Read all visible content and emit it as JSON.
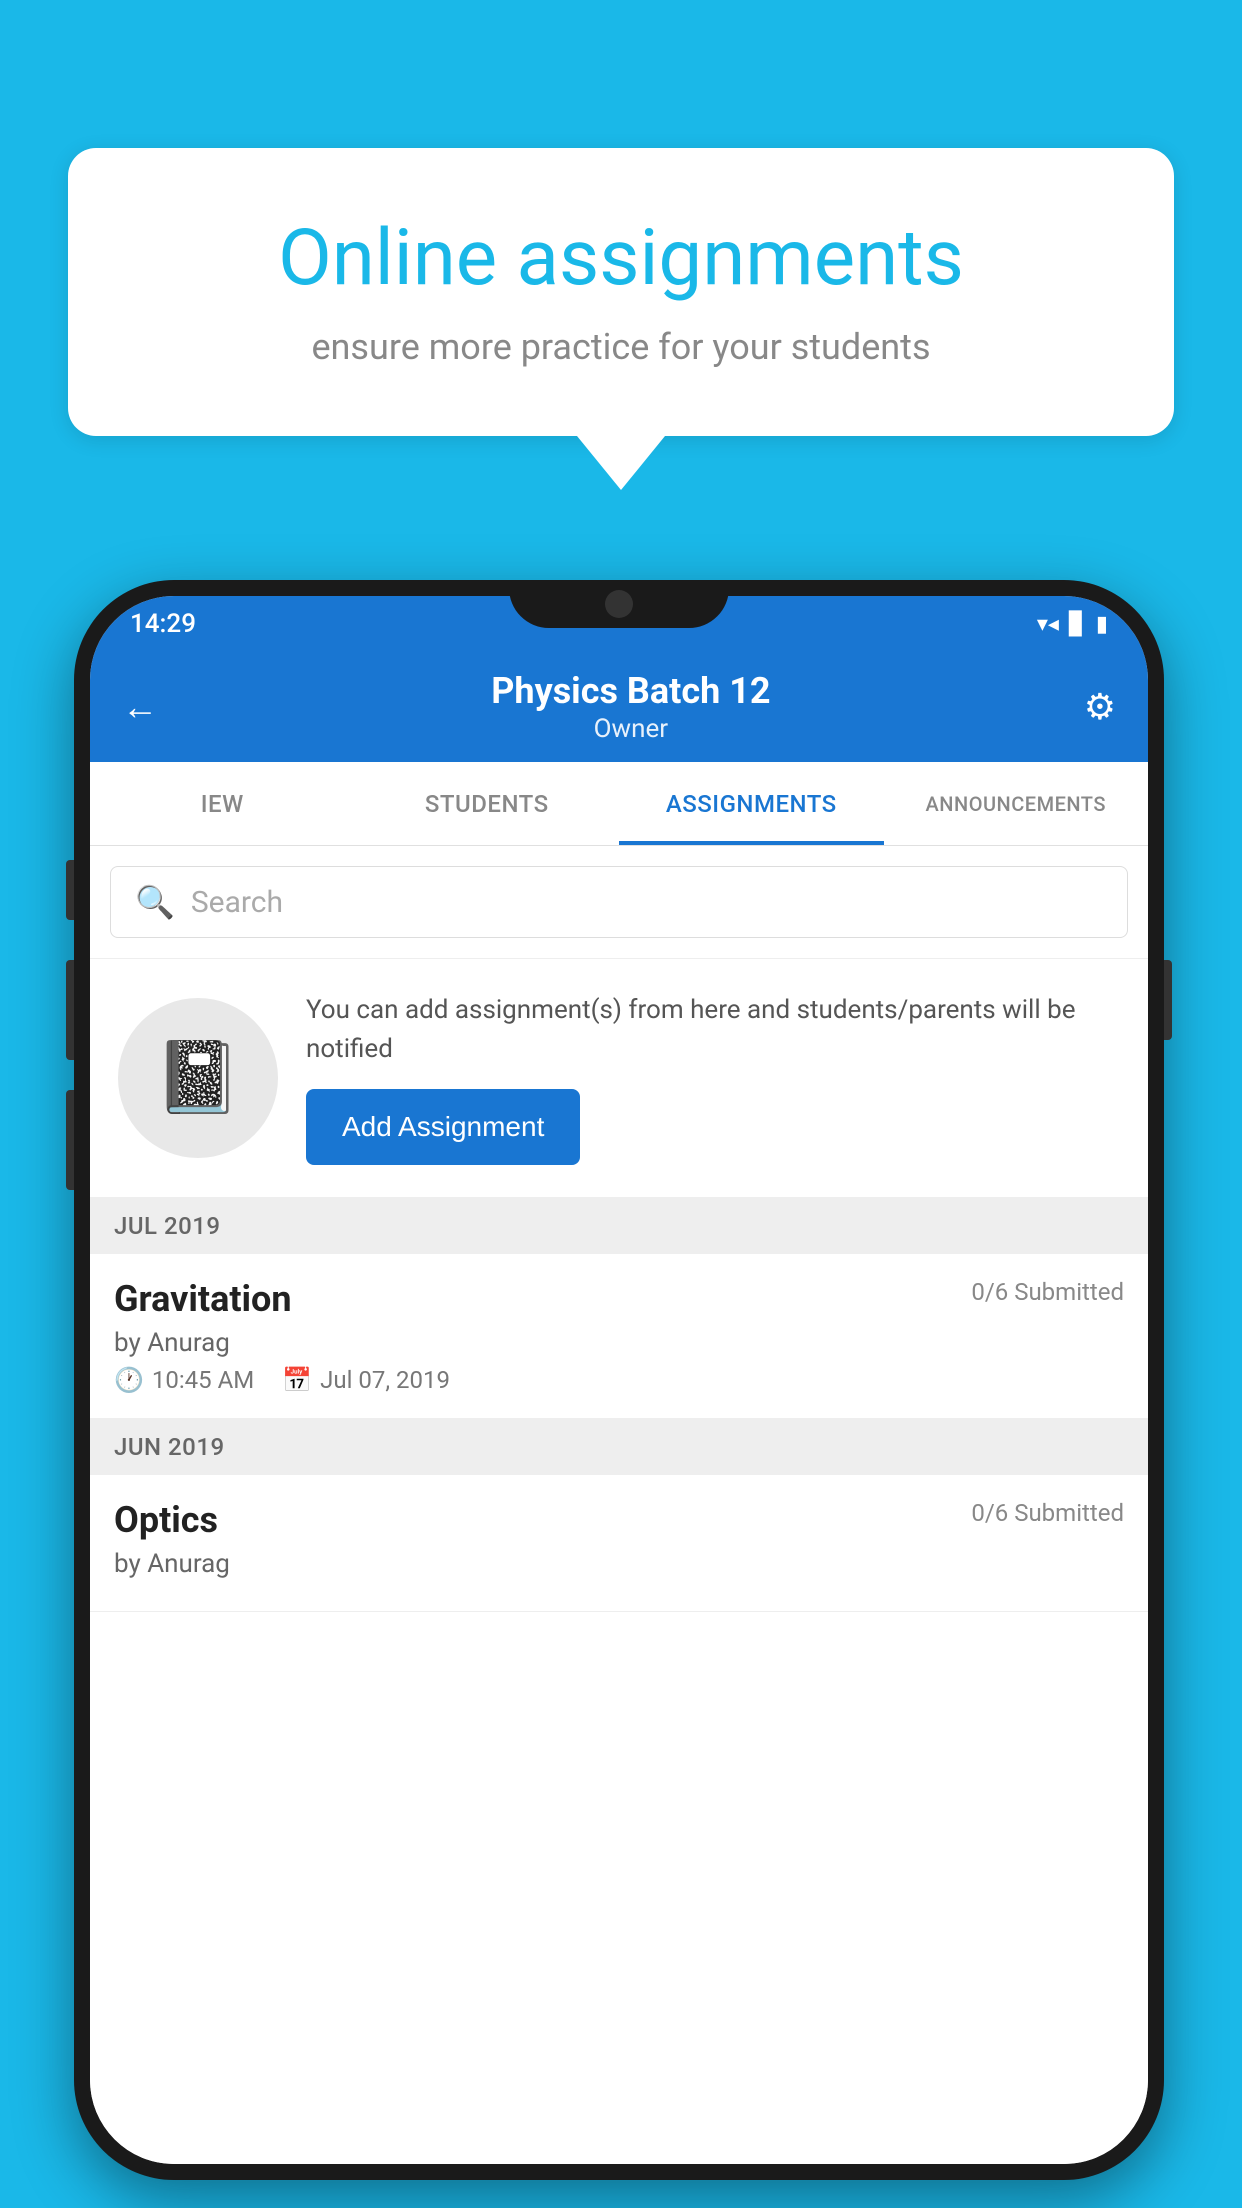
{
  "background_color": "#1ab8e8",
  "speech_bubble": {
    "title": "Online assignments",
    "subtitle": "ensure more practice for your students"
  },
  "status_bar": {
    "time": "14:29",
    "wifi_icon": "wifi",
    "signal_icon": "signal",
    "battery_icon": "battery"
  },
  "app_bar": {
    "back_label": "←",
    "title": "Physics Batch 12",
    "subtitle": "Owner",
    "settings_label": "⚙"
  },
  "tabs": [
    {
      "label": "IEW",
      "active": false
    },
    {
      "label": "STUDENTS",
      "active": false
    },
    {
      "label": "ASSIGNMENTS",
      "active": true
    },
    {
      "label": "ANNOUNCEMENTS",
      "active": false
    }
  ],
  "search": {
    "placeholder": "Search"
  },
  "empty_state": {
    "description": "You can add assignment(s) from here and students/parents will be notified",
    "button_label": "Add Assignment"
  },
  "sections": [
    {
      "label": "JUL 2019",
      "assignments": [
        {
          "name": "Gravitation",
          "submitted": "0/6 Submitted",
          "by": "by Anurag",
          "time": "10:45 AM",
          "date": "Jul 07, 2019"
        }
      ]
    },
    {
      "label": "JUN 2019",
      "assignments": [
        {
          "name": "Optics",
          "submitted": "0/6 Submitted",
          "by": "by Anurag",
          "time": "",
          "date": ""
        }
      ]
    }
  ]
}
